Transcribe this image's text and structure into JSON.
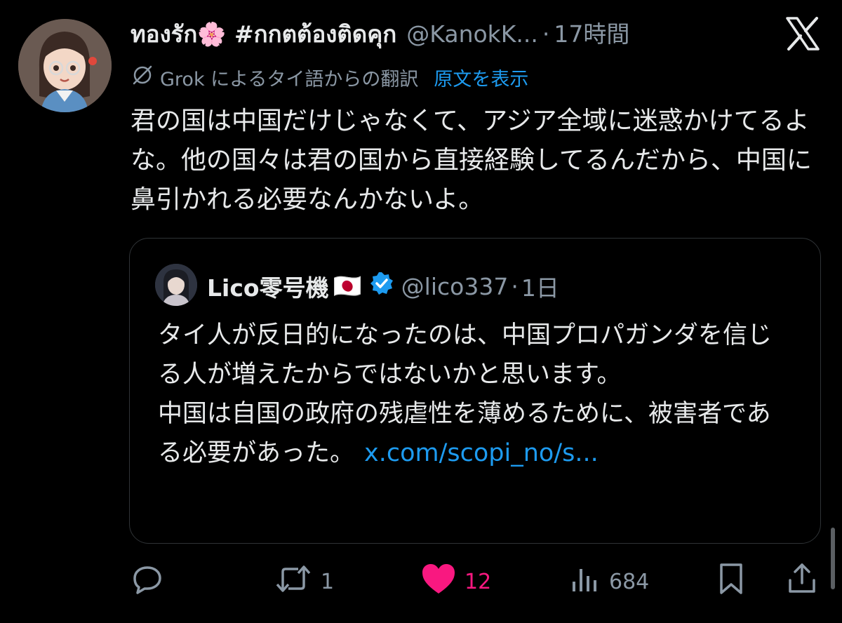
{
  "tweet": {
    "display_name": "ทองรัก🌸 #กกตต้องติดคุก",
    "handle": "@KanokK...",
    "separator": "·",
    "time": "17時間",
    "translation_label": "Grok によるタイ語からの翻訳",
    "show_original_label": "原文を表示",
    "text": "君の国は中国だけじゃなくて、アジア全域に迷惑かけてるよな。他の国々は君の国から直接経験してるんだから、中国に鼻引かれる必要なんかないよ。"
  },
  "quote": {
    "display_name": "Lico零号機",
    "flag": "🇯🇵",
    "handle": "@lico337",
    "separator": "·",
    "time": "1日",
    "text_line1": "タイ人が反日的になったのは、中国プロパガンダを信じる人が増えたからではないかと思います。",
    "text_line2": "中国は自国の政府の残虐性を薄めるために、被害者である必要があった。",
    "link": "x.com/scopi_no/s..."
  },
  "actions": {
    "reply_count": "",
    "retweet_count": "1",
    "like_count": "12",
    "view_count": "684"
  },
  "icons": {
    "x_logo": "x-logo-icon",
    "translate": "translate-slash-icon",
    "verified": "verified-badge-icon",
    "reply": "reply-icon",
    "retweet": "retweet-icon",
    "like": "heart-icon",
    "views": "views-icon",
    "bookmark": "bookmark-icon",
    "share": "share-icon"
  },
  "colors": {
    "background": "#000000",
    "text": "#e7e9ea",
    "muted": "#8b98a5",
    "link": "#1d9bf0",
    "like": "#f91880",
    "verified": "#1d9bf0"
  }
}
